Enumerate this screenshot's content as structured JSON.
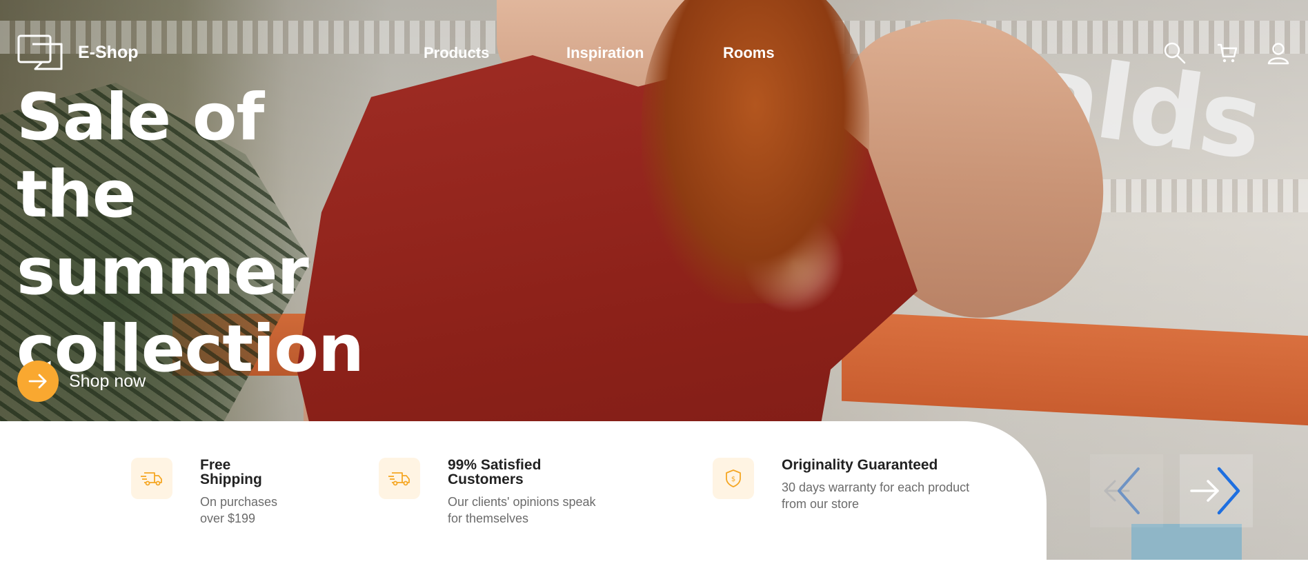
{
  "brand": {
    "name": "E-Shop"
  },
  "nav": {
    "items": [
      {
        "label": "Products"
      },
      {
        "label": "Inspiration"
      },
      {
        "label": "Rooms"
      }
    ]
  },
  "header_icons": [
    "search-icon",
    "cart-icon",
    "user-icon"
  ],
  "hero": {
    "headline_lines": [
      "Sale of the",
      "summer",
      "collection"
    ],
    "cta_label": "Shop now"
  },
  "features": [
    {
      "icon": "truck-icon",
      "title_lines": [
        "Free",
        "Shipping"
      ],
      "desc_lines": [
        "On purchases",
        "over $199"
      ]
    },
    {
      "icon": "truck-icon",
      "title_lines": [
        "99% Satisfied",
        "Customers"
      ],
      "desc_lines": [
        "Our clients' opinions speak",
        "for themselves"
      ]
    },
    {
      "icon": "shield-dollar-icon",
      "title_lines": [
        "Originality Guaranteed"
      ],
      "desc_lines": [
        "30 days warranty for each product",
        "from our store"
      ]
    }
  ],
  "colors": {
    "accent": "#f9a830",
    "feature_icon_bg": "#fff4e3",
    "text_dark": "#222222",
    "text_muted": "#6b6b6b",
    "arrow_highlight": "#1e6fe0"
  }
}
